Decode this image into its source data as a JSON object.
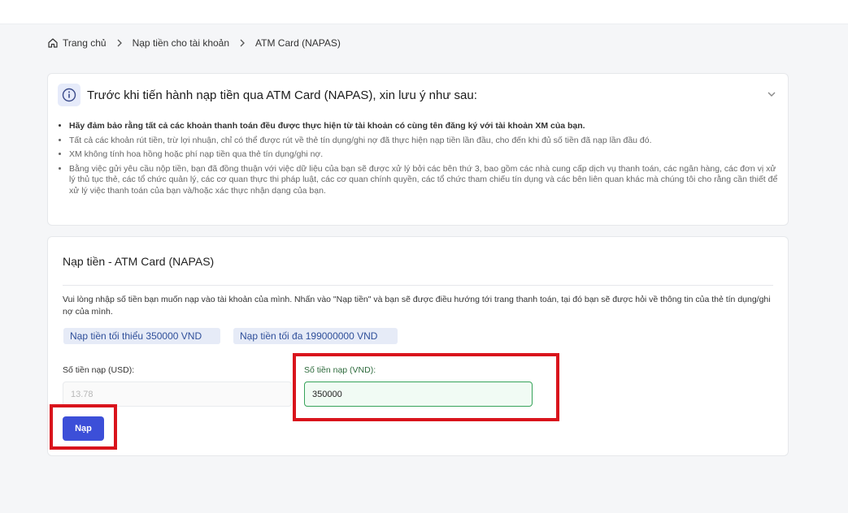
{
  "breadcrumb": {
    "home": "Trang chủ",
    "level2": "Nạp tiền cho tài khoản",
    "current": "ATM Card (NAPAS)"
  },
  "notice": {
    "title": "Trước khi tiến hành nạp tiền qua ATM Card (NAPAS), xin lưu ý như sau:",
    "items": [
      "Hãy đảm bảo rằng tất cả các khoản thanh toán đều được thực hiện từ tài khoản có cùng tên đăng ký với tài khoản XM của bạn.",
      "Tất cả các khoản rút tiền, trừ lợi nhuận, chỉ có thể được rút về thẻ tín dụng/ghi nợ đã thực hiện nạp tiền lần đầu, cho đến khi đủ số tiền đã nạp lần đầu đó.",
      "XM không tính hoa hồng hoặc phí nạp tiền qua thẻ tín dụng/ghi nợ.",
      "Bằng việc gửi yêu cầu nộp tiền, bạn đã đồng thuận với việc dữ liệu của bạn sẽ được xử lý bởi các bên thứ 3, bao gồm các nhà cung cấp dịch vụ thanh toán, các ngân hàng, các đơn vị xử lý thủ tục thẻ, các tổ chức quản lý, các cơ quan thực thi pháp luật, các cơ quan chính quyền, các tổ chức tham chiếu tín dụng và các bên liên quan khác mà chúng tôi cho rằng cần thiết để xử lý việc thanh toán của bạn và/hoặc xác thực nhận dạng của bạn."
    ]
  },
  "form": {
    "title": "Nạp tiền - ATM Card (NAPAS)",
    "description": "Vui lòng nhập số tiền bạn muốn nạp vào tài khoản của mình. Nhấn vào \"Nạp tiền\" và bạn sẽ được điều hướng tới trang thanh toán, tại đó bạn sẽ được hỏi về thông tin của thẻ tín dụng/ghi nợ của mình.",
    "min_label": "Nạp tiền tối thiểu 350000 VND",
    "max_label": "Nạp tiền tối đa 199000000 VND",
    "usd_label": "Số tiền nạp (USD):",
    "usd_value": "13.78",
    "vnd_label": "Số tiền nạp (VND):",
    "vnd_value": "350000",
    "submit_label": "Nạp"
  },
  "colors": {
    "accent": "#3c4fd8",
    "highlight": "#d9141c",
    "active_input_border": "#37a35a"
  }
}
